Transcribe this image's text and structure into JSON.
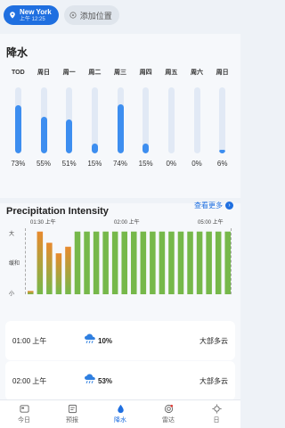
{
  "locations": {
    "active_name": "New York",
    "active_time": "上午 12:25",
    "add_label": "添加位置"
  },
  "precip": {
    "title": "降水",
    "days": [
      {
        "label": "TOD",
        "percent": 73,
        "text": "73%"
      },
      {
        "label": "周日",
        "percent": 55,
        "text": "55%"
      },
      {
        "label": "周一",
        "percent": 51,
        "text": "51%"
      },
      {
        "label": "周二",
        "percent": 15,
        "text": "15%"
      },
      {
        "label": "周三",
        "percent": 74,
        "text": "74%"
      },
      {
        "label": "周四",
        "percent": 15,
        "text": "15%"
      },
      {
        "label": "周五",
        "percent": 0,
        "text": "0%"
      },
      {
        "label": "周六",
        "percent": 0,
        "text": "0%"
      },
      {
        "label": "周日",
        "percent": 6,
        "text": "6%"
      }
    ]
  },
  "intensity": {
    "title": "Precipitation Intensity",
    "more_label": "查看更多",
    "y_labels": [
      "大",
      "缓和",
      "小"
    ],
    "time_labels": [
      "01:30 上午",
      "02:00 上午",
      "05:00 上午"
    ]
  },
  "chart_data": {
    "type": "bar",
    "y_levels": [
      "小",
      "缓和",
      "大"
    ],
    "ylim": [
      0,
      1
    ],
    "values": [
      0.05,
      0.95,
      0.78,
      0.62,
      0.72,
      0.95,
      0.95,
      0.95,
      0.95,
      0.95,
      0.95,
      0.95,
      0.95,
      0.95,
      0.95,
      0.95,
      0.95,
      0.95,
      0.95,
      0.95,
      0.95,
      0.95
    ]
  },
  "hourly": [
    {
      "time": "01:00 上午",
      "pct": "10%",
      "condition": "大部多云"
    },
    {
      "time": "02:00 上午",
      "pct": "53%",
      "condition": "大部多云"
    }
  ],
  "nav": {
    "items": [
      {
        "label": "今日"
      },
      {
        "label": "预报"
      },
      {
        "label": "降水"
      },
      {
        "label": "雷达"
      },
      {
        "label": "日"
      }
    ]
  },
  "colors": {
    "accent": "#1f6fe0",
    "bar_fill": "#3d8ef0",
    "intensity_green": "#76b84a",
    "intensity_orange": "#e88a2e"
  }
}
